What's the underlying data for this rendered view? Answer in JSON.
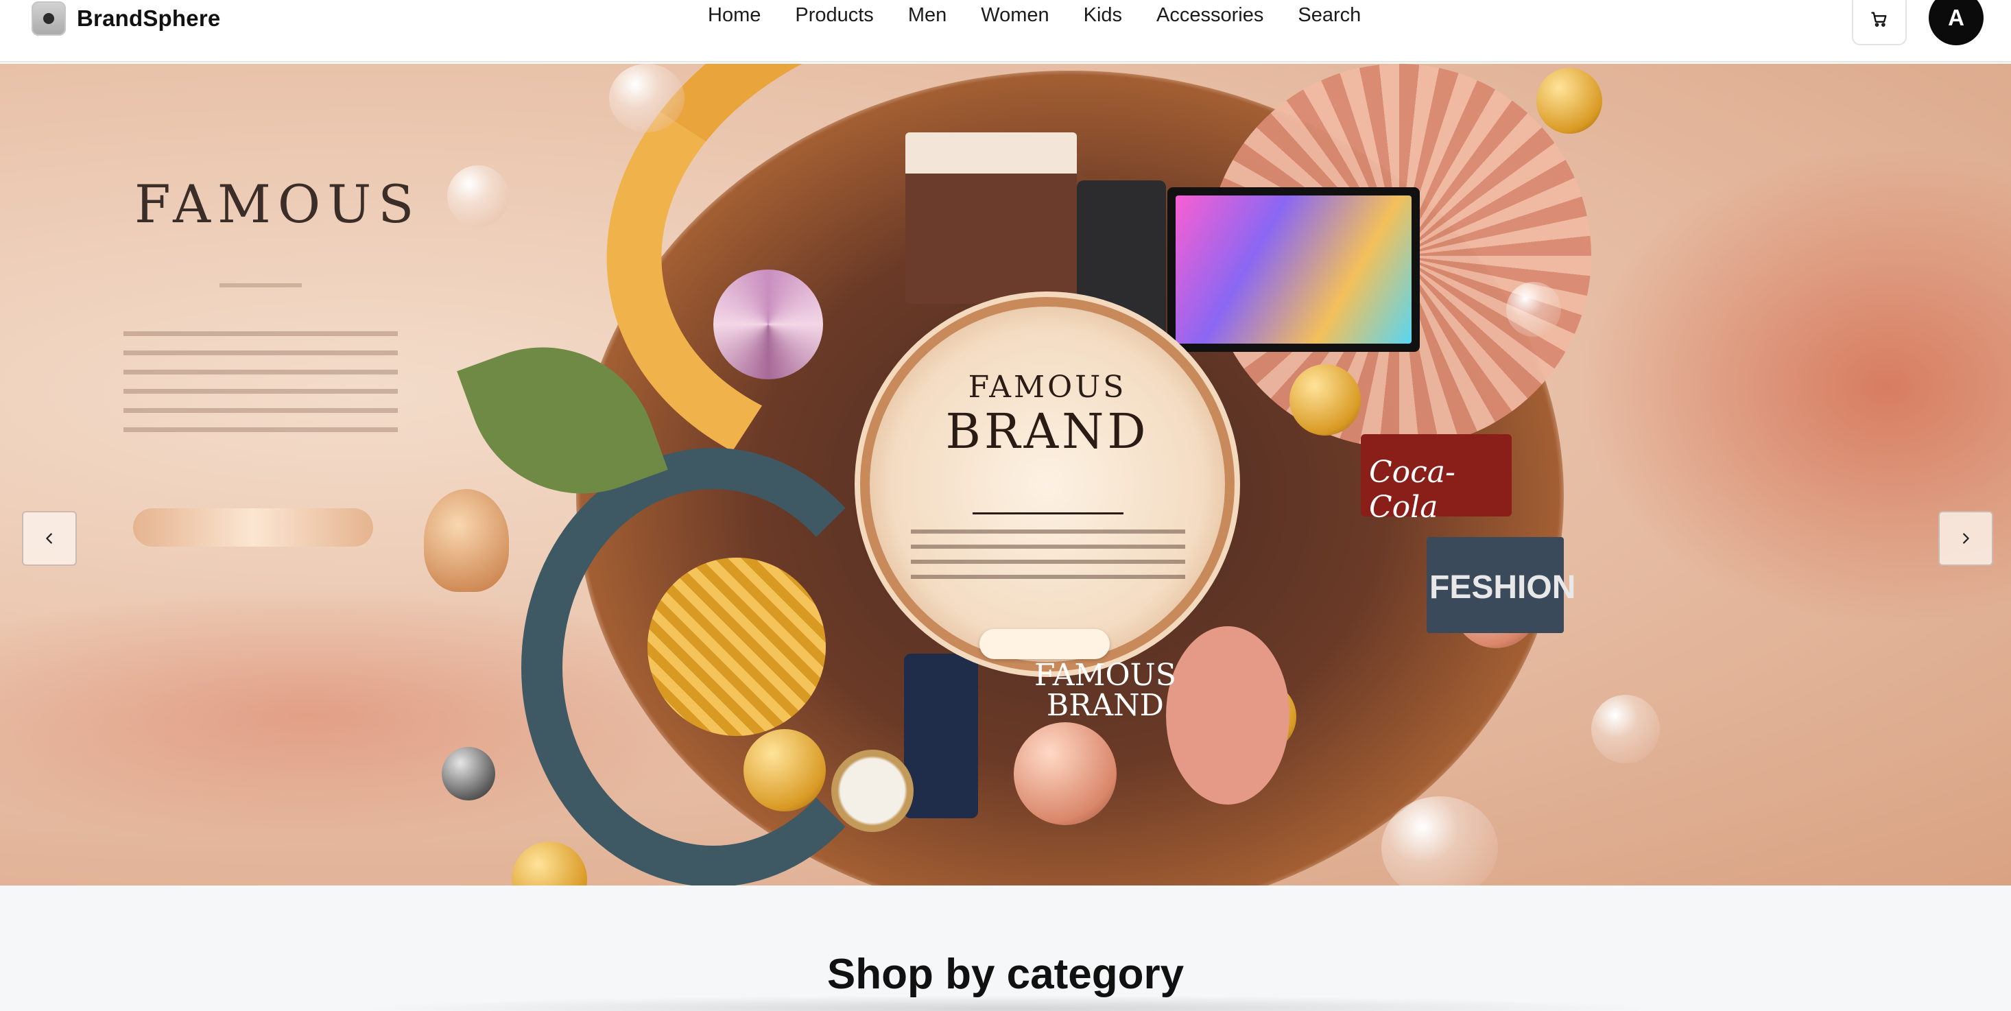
{
  "header": {
    "brand_name": "BrandSphere",
    "nav": [
      "Home",
      "Products",
      "Men",
      "Women",
      "Kids",
      "Accessories",
      "Search"
    ],
    "avatar_initial": "A",
    "icons": {
      "cart": "cart-icon",
      "logo": "brand-logo-icon"
    }
  },
  "hero": {
    "left_heading": "FAMOUS",
    "medallion_line1": "FAMOUS",
    "medallion_line2": "BRAND",
    "badge_fashion": "FESHION",
    "badge_coke": "Coca-Cola",
    "bottom_logo_line1": "FAMOUS",
    "bottom_logo_line2": "BRAND",
    "prev_icon": "chevron-left-icon",
    "next_icon": "chevron-right-icon"
  },
  "category": {
    "title": "Shop by category"
  },
  "colors": {
    "accent_dark": "#0b0b0b",
    "hero_base": "#e9c3ab",
    "section_bg": "#f6f7f9"
  }
}
